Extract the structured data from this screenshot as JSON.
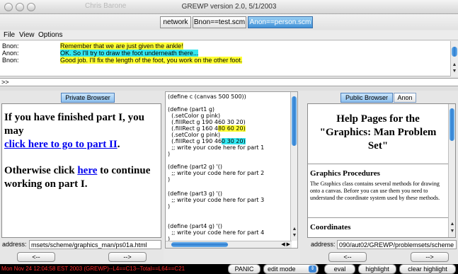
{
  "window": {
    "ghost_user": "Chris Barone",
    "title": "GREWP version 2.0, 5/1/2003"
  },
  "top_tabs": [
    {
      "label": "network"
    },
    {
      "label": "Bnon==test.scm"
    },
    {
      "label": "Anon==person.scm"
    }
  ],
  "menu": [
    "File",
    "View",
    "Options"
  ],
  "chat": {
    "messages": [
      {
        "who": "Bnon:",
        "text": "Remember that we are just given the ankle!",
        "color": "#ffff33"
      },
      {
        "who": "Anon:",
        "text": "OK. So I'll try to draw the foot underneath there...",
        "color": "#33e6f0"
      },
      {
        "who": "Bnon:",
        "text": "Good job. I'll fix the length of the foot, you work on the other foot.",
        "color": "#ffff33"
      }
    ],
    "prompt": ">>"
  },
  "private_browser": {
    "tab_label": "Private Browser",
    "text1": "If you have finished part I, you may",
    "link1": "click here to go to part II",
    "after_link1": ".",
    "text2_before": "Otherwise click ",
    "link2": "here",
    "text2_after": " to continue working on part I.",
    "address_label": "address:",
    "address_value": "msets/scheme/graphics_man/ps01a.html",
    "back_label": "<--",
    "forward_label": "-->"
  },
  "code_editor": {
    "lines": [
      "(define c (canvas 500 500))",
      "",
      "(define (part1 g)",
      "  (.setColor g pink)",
      "  (.fillRect g 190 460 30 20)",
      "  (.fillRect g 160 480 60 20)",
      "  (.setColor g pink)",
      "  (.fillRect g 190 460 30 20)",
      "  ;; write your code here for part 1",
      ")",
      "",
      "(define (part2 g) '()",
      "  ;; write your code here for part 2",
      ")",
      "",
      "(define (part3 g) '()",
      "  ;; write your code here for part 3",
      ")",
      "",
      "(define (part4 g) '()",
      "  ;; write your code here for part 4",
      ")"
    ],
    "hl_yellow_prefix": "  (.fillRect g 160 4",
    "hl_yellow_text": "80 60 20)",
    "hl_cyan_prefix": "  (.fillRect g 190 46",
    "hl_cyan_text": "0 30 20)"
  },
  "public_browser": {
    "tabs": [
      {
        "label": "Public Browser"
      },
      {
        "label": "Anon"
      }
    ],
    "heading": "Help Pages for the \"Graphics: Man Problem Set\"",
    "section1_title": "Graphics Procedures",
    "section1_text": "The Graphics class contains several methods for drawing onto a canvas. Before you can use them you need to understand the coordinate system used by these methods.",
    "section2_title": "Coordinates",
    "address_label": "address:",
    "address_value": "090/aut02/GREWP/problemsets/scheme",
    "back_label": "<--",
    "forward_label": "-->"
  },
  "statusbar": {
    "text": "Mon Nov 24 12:04:58 EST 2003 (GREWP)--L4==C13--Total==L64==C21",
    "panic": "PANIC",
    "mode": "edit mode",
    "eval": "eval",
    "highlight": "highlight",
    "clear_highlight": "clear highlight"
  }
}
